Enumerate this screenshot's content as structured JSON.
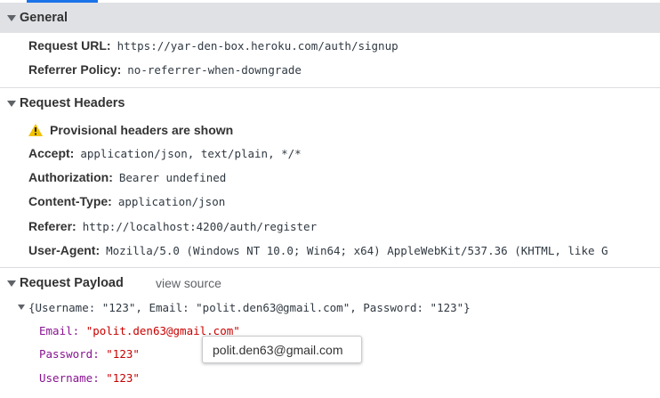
{
  "general": {
    "title": "General",
    "request_url_label": "Request URL:",
    "request_url_value": "https://yar-den-box.heroku.com/auth/signup",
    "referrer_policy_label": "Referrer Policy:",
    "referrer_policy_value": "no-referrer-when-downgrade"
  },
  "request_headers": {
    "title": "Request Headers",
    "warning": "Provisional headers are shown",
    "items": [
      {
        "label": "Accept:",
        "value": "application/json, text/plain, */*"
      },
      {
        "label": "Authorization:",
        "value": "Bearer undefined"
      },
      {
        "label": "Content-Type:",
        "value": "application/json"
      },
      {
        "label": "Referer:",
        "value": "http://localhost:4200/auth/register"
      },
      {
        "label": "User-Agent:",
        "value": "Mozilla/5.0 (Windows NT 10.0; Win64; x64) AppleWebKit/537.36 (KHTML, like G"
      }
    ]
  },
  "request_payload": {
    "title": "Request Payload",
    "view_source": "view source",
    "summary": "{Username: \"123\", Email: \"polit.den63@gmail.com\", Password: \"123\"}",
    "props": [
      {
        "key": "Email:",
        "value": "\"polit.den63@gmail.com\""
      },
      {
        "key": "Password:",
        "value": "\"123\""
      },
      {
        "key": "Username:",
        "value": "\"123\""
      }
    ]
  },
  "tooltip": "polit.den63@gmail.com",
  "colors": {
    "accent": "#1a73e8",
    "prop_key": "#881391",
    "prop_string": "#c80000",
    "warning": "#f2c200"
  },
  "icons": {
    "warning": "warning-icon",
    "expand": "triangle-down-icon"
  }
}
